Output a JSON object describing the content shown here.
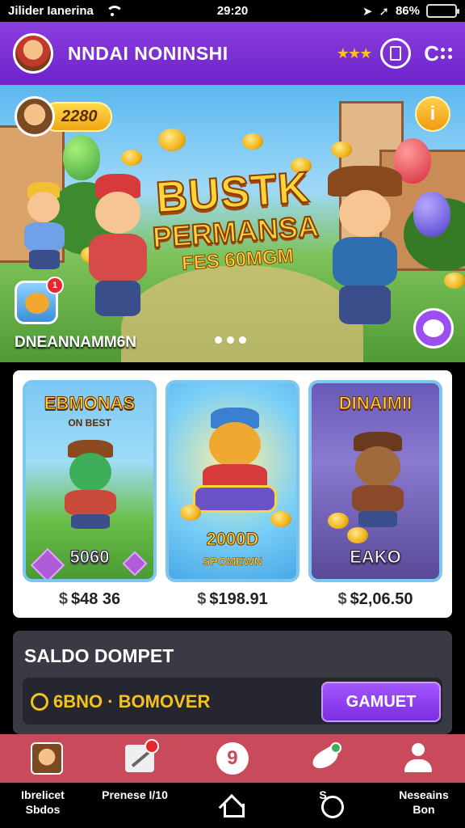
{
  "status_bar": {
    "carrier": "Jilider Ianerina",
    "time": "29:20",
    "battery": "86%",
    "battery_level": 0.72
  },
  "app_bar": {
    "title": "NNDAI NONINSHI",
    "stars": "★★★",
    "c_glyph": "C"
  },
  "hero": {
    "score": "2280",
    "info_glyph": "i",
    "title_line1": "BUSTK",
    "title_line2": "PERMANSA",
    "title_line3": "FES 60MGM",
    "badge_count": "1",
    "caption": "DNEANNAMM6N"
  },
  "cards": [
    {
      "title": "EBMONAS",
      "subtitle": "ON BEST",
      "label": "5060",
      "price": "$48 36",
      "price_symbol": "$"
    },
    {
      "title": "",
      "subtitle": "",
      "label": "2000D",
      "label_sub": "SPOMEWN",
      "price": "$198.91",
      "price_symbol": "$"
    },
    {
      "title": "DINAIMII",
      "subtitle": "",
      "label": "EAKO",
      "price": "$2,06.50",
      "price_symbol": "$"
    }
  ],
  "wallet": {
    "title": "SALDO DOMPET",
    "value": "6BNO · BOMOVER",
    "button_label": "GAMUET"
  },
  "tab_bar": {
    "game_glyph": "9"
  },
  "nav_bar": {
    "left_label": "Ibrelicet Sbdos",
    "left2_label": "Prenese I/10",
    "right1_label": "S",
    "right2_label": "Neseains Bon"
  },
  "colors": {
    "app_bar": "#7b2fd6",
    "tab_bar": "#c94a5a",
    "gold": "#ffd33a",
    "wallet_bg": "#3a3a44",
    "button": "#8b3cf0"
  }
}
